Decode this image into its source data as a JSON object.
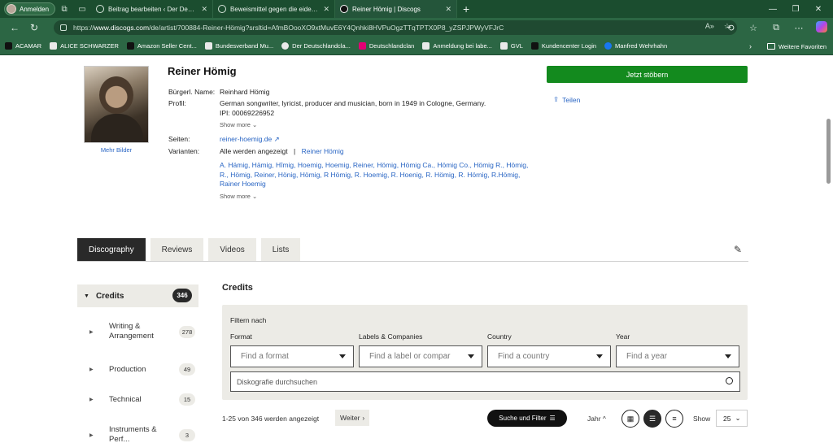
{
  "browser": {
    "profile_label": "Anmelden",
    "tabs": [
      {
        "title": "Beitrag bearbeiten ‹ Der Deutschl",
        "icon": "globe-icon",
        "active": false
      },
      {
        "title": "Beweismittel gegen die eidesstatt",
        "icon": "globe-icon",
        "active": false
      },
      {
        "title": "Reiner Hömig | Discogs",
        "icon": "discogs-icon",
        "active": true
      }
    ],
    "url_prefix": "https://",
    "url_host": "www.discogs.com",
    "url_path": "/de/artist/700884-Reiner-Hömig?srsltid=AfmBOooXO9xtMuvE6Y4Qnhki8HVPuOgzTTqTPTX0P8_yZSPJPWyVFJrC",
    "bookmarks": [
      {
        "label": "ACAMAR",
        "icon": "acamar-icon"
      },
      {
        "label": "ALICE SCHWARZER",
        "icon": "pin-icon"
      },
      {
        "label": "Amazon Seller Cent...",
        "icon": "amazon-icon"
      },
      {
        "label": "Bundesverband Mu...",
        "icon": "site-icon"
      },
      {
        "label": "Der Deutschlandcla...",
        "icon": "globe-icon"
      },
      {
        "label": "Deutschlandclan",
        "icon": "telekom-icon"
      },
      {
        "label": "Anmeldung bei labe...",
        "icon": "site-icon"
      },
      {
        "label": "GVL",
        "icon": "gvl-icon"
      },
      {
        "label": "Kundencenter Login",
        "icon": "mf-icon"
      },
      {
        "label": "Manfred Wehrhahn",
        "icon": "facebook-icon"
      }
    ],
    "favorites_label": "Weitere Favoriten"
  },
  "artist": {
    "name": "Reiner Hömig",
    "more_images": "Mehr Bilder",
    "real_name_label": "Bürgerl. Name:",
    "real_name": "Reinhard Hömig",
    "profile_label": "Profil:",
    "profile_text": "German songwriter, lyricist, producer and musician, born in 1949 in Cologne, Germany.",
    "ipi": "IPI: 00069226952",
    "show_more": "Show more ⌄",
    "sites_label": "Seiten:",
    "site": "reiner-hoemig.de",
    "variants_label": "Varianten:",
    "variants_shown": "Alle werden angezeigt",
    "variants_sep": "|",
    "variants_current": "Reiner Hömig",
    "variants_list": "A. Hämig, Hämig, Hîmig, Hoemig, Hoemig, Reiner, Hömig, Hömig Ca., Hömig Co., Hömig R., Hömig, R., Hömig, Reiner, Hönig, Hömig, R Hömig, R. Hoemig, R. Hoenig, R. Hömig, R. Hörnig, R.Hömig, Rainer Hoemig",
    "show_more_2": "Show more ⌄",
    "explore_button": "Jetzt stöbern",
    "share": "Teilen"
  },
  "page_tabs": [
    "Discography",
    "Reviews",
    "Videos",
    "Lists"
  ],
  "sidebar": {
    "credits_label": "Credits",
    "credits_count": "346",
    "items": [
      {
        "label": "Writing & Arrangement",
        "count": "278"
      },
      {
        "label": "Production",
        "count": "49"
      },
      {
        "label": "Technical",
        "count": "15"
      },
      {
        "label": "Instruments & Perf...",
        "count": "3"
      }
    ]
  },
  "filter": {
    "title": "Credits",
    "filter_by": "Filtern nach",
    "format_label": "Format",
    "format_placeholder": "Find a format",
    "labels_label": "Labels & Companies",
    "labels_placeholder": "Find a label or compar",
    "country_label": "Country",
    "country_placeholder": "Find a country",
    "year_label": "Year",
    "year_placeholder": "Find a year",
    "search_placeholder": "Diskografie durchsuchen"
  },
  "results": {
    "count_text": "1-25 von 346 werden angezeigt",
    "next": "Weiter",
    "search_filter_button": "Suche und Filter",
    "sort": "Jahr",
    "show_label": "Show",
    "page_size": "25"
  },
  "colors": {
    "browser_chrome": "#2c6644",
    "accent_green": "#138a1e",
    "link_blue": "#2a66c4",
    "tab_active": "#292929"
  }
}
